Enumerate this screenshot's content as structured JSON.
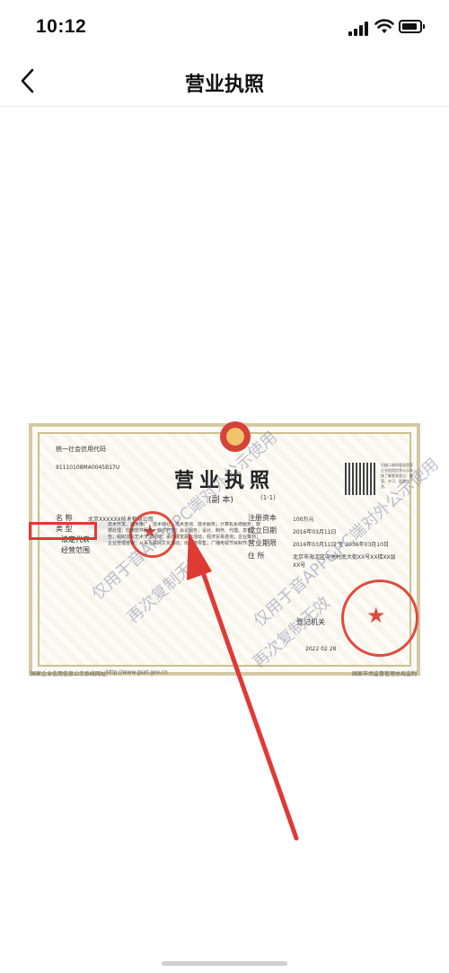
{
  "status": {
    "time": "10:12"
  },
  "nav": {
    "title": "营业执照"
  },
  "license": {
    "title": "营业执照",
    "subtitle": "(副 本)",
    "copy_number": "(1-1)",
    "credit_code_label": "统一社会信用代码",
    "credit_code": "91110108MA0045B17U",
    "name_label": "名 称",
    "name_value": "北京XXXXXX技术有限公司",
    "type_label": "类 型",
    "legal_rep_label": "法定代表",
    "scope_label": "经营范围",
    "scope_text": "技术开发、技术推广、技术转让、技术咨询、技术服务；计算机系统服务；数据处理；应用软件服务；软件开发；会议服务；设计、制作、代理、发布广告；组织文化艺术交流活动；承办展览展示活动；经济贸易咨询；企业策划；企业管理咨询；从事互联网文化活动；出版物零售；广播电视节目制作。",
    "capital_label": "注册资本",
    "capital_value": "100万元",
    "date_label": "成立日期",
    "date_value": "2016年03月11日",
    "term_label": "营业期限",
    "term_value": "2016年03月11日 至 2036年03月10日",
    "address_label": "住 所",
    "address_value": "北京市海淀区中关村南大街XX号XX楼XX层XX号",
    "authority_label": "登记机关",
    "issue_date": "2022 02 28",
    "footer_left": "国家企业信用信息公示系统网址：",
    "footer_url": "http://www.gsxt.gov.cn",
    "footer_right": "国家市场监督管理总局监制",
    "qr_note": "扫描二维码登录国家企业信用信息公示系统了解更多登记、备案、许可、监管信息。",
    "watermarks": [
      "仅用于音APP&PC端对外公示使用",
      "再次复制无效"
    ]
  },
  "colors": {
    "accent": "#e03a35"
  }
}
